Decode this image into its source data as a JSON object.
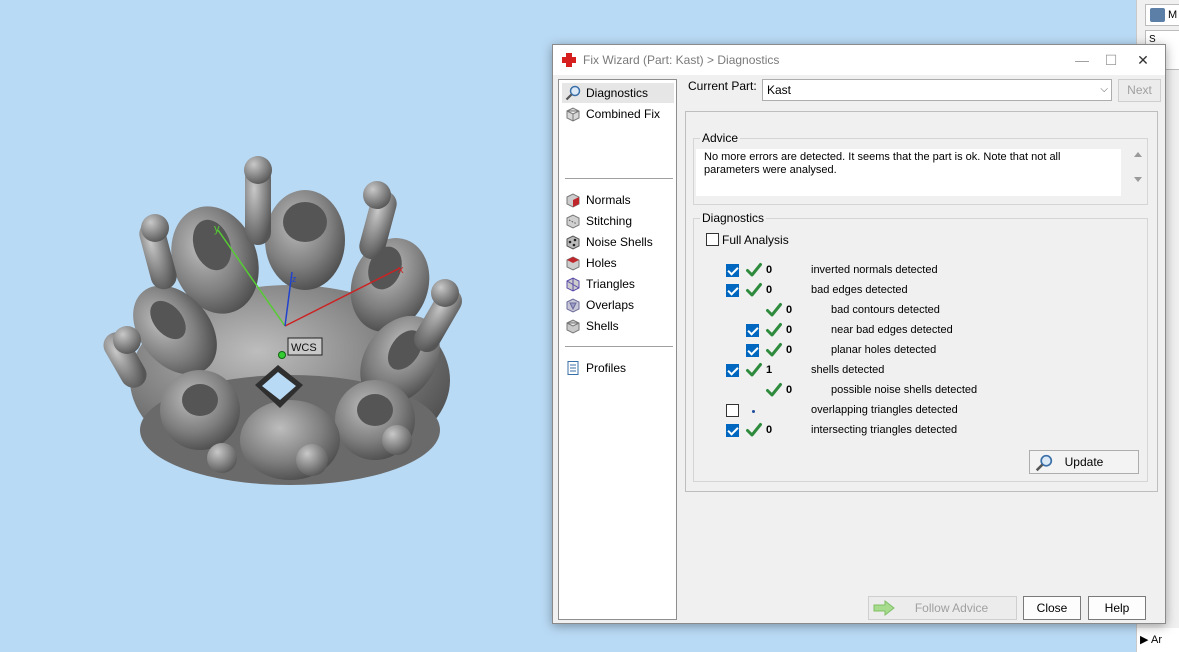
{
  "dialog": {
    "title": "Fix Wizard (Part: Kast) > Diagnostics",
    "minimize": "—",
    "maximize": "☐",
    "close": "✕"
  },
  "sidebar": {
    "items_top": [
      {
        "label": "Diagnostics",
        "icon": "magnifier-icon",
        "active": true
      },
      {
        "label": "Combined Fix",
        "icon": "cube-icon"
      }
    ],
    "items_mid": [
      {
        "label": "Normals",
        "icon": "normals-cube-icon"
      },
      {
        "label": "Stitching",
        "icon": "stitching-cube-icon"
      },
      {
        "label": "Noise Shells",
        "icon": "noise-shells-icon"
      },
      {
        "label": "Holes",
        "icon": "holes-cube-icon"
      },
      {
        "label": "Triangles",
        "icon": "triangles-cube-icon"
      },
      {
        "label": "Overlaps",
        "icon": "overlaps-cube-icon"
      },
      {
        "label": "Shells",
        "icon": "shells-cube-icon"
      }
    ],
    "items_bottom": [
      {
        "label": "Profiles",
        "icon": "document-icon"
      }
    ]
  },
  "current_part": {
    "label": "Current Part:",
    "value": "Kast",
    "next": "Next"
  },
  "advice": {
    "title": "Advice",
    "text": "No more errors are detected. It seems that the part is ok. Note that not all parameters were analysed."
  },
  "diagnostics": {
    "title": "Diagnostics",
    "full_analysis": "Full Analysis",
    "rows": [
      {
        "checkbox": true,
        "checked": true,
        "status": "ok",
        "count": "0",
        "label": "inverted normals detected",
        "indent": 0
      },
      {
        "checkbox": true,
        "checked": true,
        "status": "ok",
        "count": "0",
        "label": "bad edges detected",
        "indent": 0
      },
      {
        "checkbox": false,
        "checked": false,
        "status": "ok",
        "count": "0",
        "label": "bad contours detected",
        "indent": 1
      },
      {
        "checkbox": true,
        "checked": true,
        "status": "ok",
        "count": "0",
        "label": "near bad edges detected",
        "indent": 1
      },
      {
        "checkbox": true,
        "checked": true,
        "status": "ok",
        "count": "0",
        "label": "planar holes detected",
        "indent": 1
      },
      {
        "checkbox": true,
        "checked": true,
        "status": "ok",
        "count": "1",
        "label": "shells detected",
        "indent": 0
      },
      {
        "checkbox": false,
        "checked": false,
        "status": "ok",
        "count": "0",
        "label": "possible noise shells detected",
        "indent": 1
      },
      {
        "checkbox": true,
        "checked": false,
        "status": "dot",
        "count": "",
        "label": "overlapping triangles detected",
        "indent": 0
      },
      {
        "checkbox": true,
        "checked": true,
        "status": "ok",
        "count": "0",
        "label": "intersecting triangles detected",
        "indent": 0
      }
    ],
    "update": "Update"
  },
  "footer": {
    "follow_advice": "Follow Advice",
    "close": "Close",
    "help": "Help"
  },
  "viewport": {
    "wcs_label": "WCS",
    "axis_x": "x",
    "axis_y": "y",
    "axis_z": "z"
  },
  "right_strip": {
    "top_label": "M",
    "mid_label": "S",
    "bottom_label": "Ar"
  }
}
